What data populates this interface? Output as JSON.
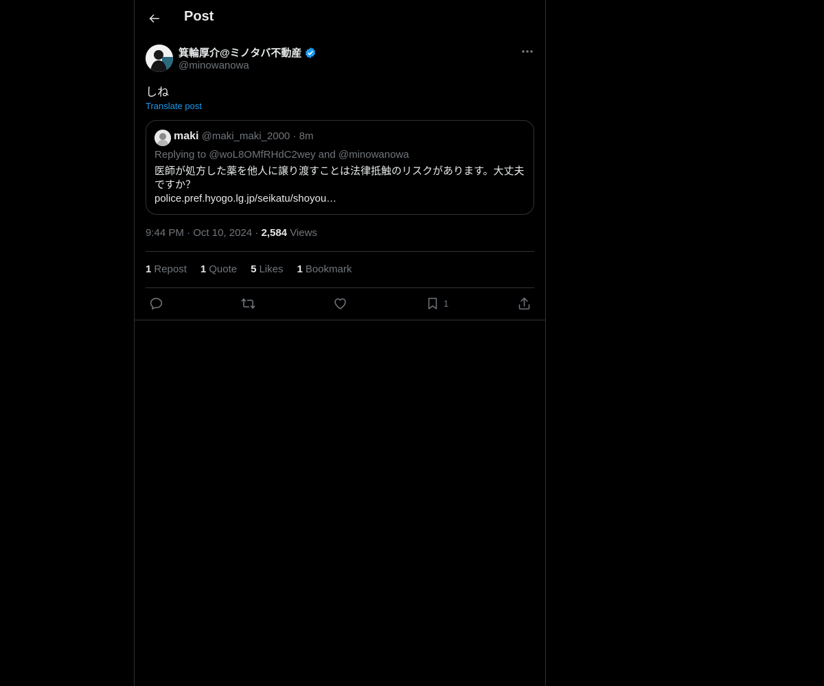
{
  "header": {
    "title": "Post",
    "back_icon": "arrow-left-icon"
  },
  "author": {
    "name": "箕輪厚介@ミノタバ不動産",
    "handle": "@minowanowa",
    "verified_icon": "verified-badge-icon",
    "verified_color": "#1d9bf0"
  },
  "post": {
    "text": "しね",
    "translate_label": "Translate post"
  },
  "quote": {
    "name": "maki",
    "handle": "@maki_maki_2000",
    "separator": "·",
    "time": "8m",
    "replying_to": "Replying to @woL8OMfRHdC2wey and @minowanowa",
    "body": "医師が処方した薬を他人に譲り渡すことは法律抵触のリスクがあります。大丈夫ですか？",
    "link": "police.pref.hyogo.lg.jp/seikatu/shoyou…"
  },
  "meta": {
    "time": "9:44 PM",
    "date": "Oct 10, 2024",
    "separator": "·",
    "views_count": "2,584",
    "views_label": "Views"
  },
  "stats": {
    "reposts": {
      "count": "1",
      "label": "Repost"
    },
    "quotes": {
      "count": "1",
      "label": "Quote"
    },
    "likes": {
      "count": "5",
      "label": "Likes"
    },
    "bookmarks": {
      "count": "1",
      "label": "Bookmark"
    }
  },
  "actions": {
    "reply_icon": "reply-icon",
    "repost_icon": "repost-icon",
    "like_icon": "heart-icon",
    "bookmark_icon": "bookmark-icon",
    "bookmark_count": "1",
    "share_icon": "share-icon"
  },
  "colors": {
    "background": "#000000",
    "text": "#e7e9ea",
    "muted": "#71767b",
    "accent": "#1d9bf0",
    "border": "#2f3336"
  }
}
